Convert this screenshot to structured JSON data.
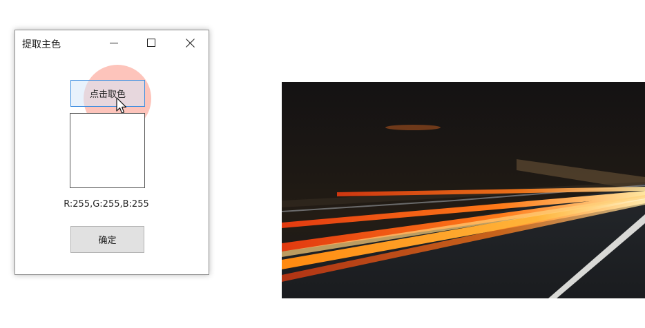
{
  "window": {
    "title": "提取主色",
    "controls": {
      "minimize_icon": "minimize-icon",
      "maximize_icon": "maximize-icon",
      "close_icon": "close-icon"
    }
  },
  "picker": {
    "pick_button_label": "点击取色",
    "swatch_color": "#ffffff",
    "rgb_readout": "R:255,G:255,B:255",
    "ok_button_label": "确定"
  },
  "photo": {
    "subject": "night-highway-light-trails",
    "icon": "photo-image"
  },
  "colors": {
    "window_border": "#8f8f8f",
    "button_focus_border": "#3d8ee0",
    "button_bg": "#e1e1e1",
    "click_highlight": "#fcb0a4"
  }
}
